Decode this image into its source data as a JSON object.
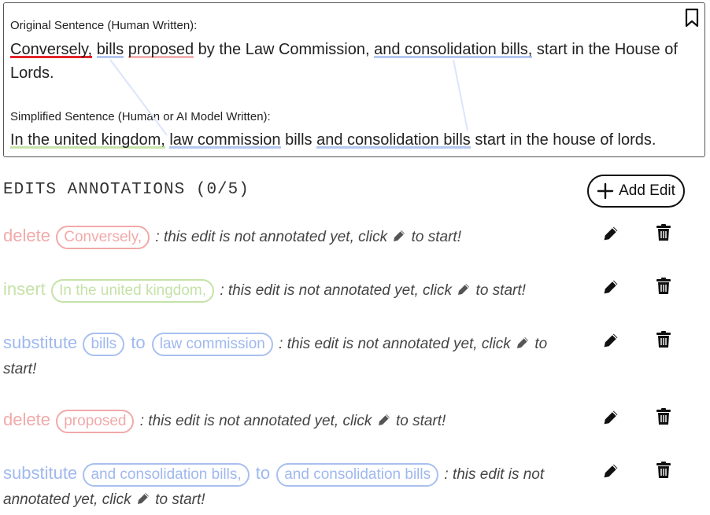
{
  "original": {
    "label": "Original Sentence (Human Written):",
    "segments": [
      {
        "text": "Conversely,",
        "u": "red"
      },
      {
        "text": " "
      },
      {
        "text": "bills",
        "u": "blue"
      },
      {
        "text": " "
      },
      {
        "text": "proposed",
        "u": "pink"
      },
      {
        "text": " by the Law Commission, "
      },
      {
        "text": "and consolidation bills,",
        "u": "blue"
      },
      {
        "text": " start in the House of Lords."
      }
    ]
  },
  "simplified": {
    "label": "Simplified Sentence (Human or AI Model Written):",
    "segments": [
      {
        "text": "In the united kingdom,",
        "u": "green"
      },
      {
        "text": " "
      },
      {
        "text": "law commission",
        "u": "blue"
      },
      {
        "text": " bills "
      },
      {
        "text": "and consolidation bills",
        "u": "blue"
      },
      {
        "text": " start in the house of lords."
      }
    ]
  },
  "annotations": {
    "title": "EDITS ANNOTATIONS (0/5)",
    "add_button": "Add Edit",
    "note_before": ": this edit is not annotated yet, click",
    "note_after": "to start!",
    "to_word": "to",
    "edits": [
      {
        "op": "delete",
        "type": "delete",
        "chips": [
          "Conversely,"
        ]
      },
      {
        "op": "insert",
        "type": "insert",
        "chips": [
          "In the united kingdom,"
        ]
      },
      {
        "op": "substitute",
        "type": "sub",
        "chips": [
          "bills",
          "law commission"
        ]
      },
      {
        "op": "delete",
        "type": "delete",
        "chips": [
          "proposed"
        ]
      },
      {
        "op": "substitute",
        "type": "sub",
        "chips": [
          "and consolidation bills,",
          "and consolidation bills"
        ]
      }
    ]
  },
  "icons": {
    "bookmark": "bookmark-icon",
    "plus": "plus-icon",
    "pencil": "pencil-icon",
    "trash": "trash-icon"
  },
  "colors": {
    "delete": "#f2a9a9",
    "insert": "#c5e2a8",
    "substitute": "#9fb8ef",
    "deep_red": "#e3242b"
  }
}
